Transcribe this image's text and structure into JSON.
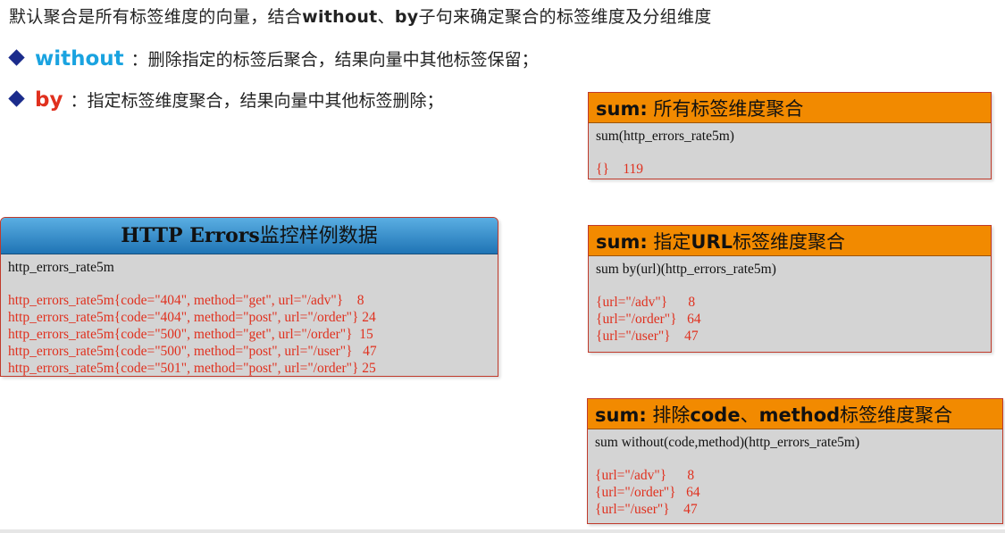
{
  "title": {
    "pre": "默认聚合是所有标签维度的向量，结合",
    "kw1": "without",
    "mid": "、",
    "kw2": "by",
    "post": "子句来确定聚合的标签维度及分组维度"
  },
  "bullets": [
    {
      "keyword": "without",
      "text": "：删除指定的标签后聚合，结果向量中其他标签保留；"
    },
    {
      "keyword": "by",
      "text": "：指定标签维度聚合，结果向量中其他标签删除；"
    }
  ],
  "sample": {
    "header_en": "HTTP Errors",
    "header_cn": "监控样例数据",
    "command": "http_errors_rate5m",
    "rows": [
      "http_errors_rate5m{code=\"404\", method=\"get\", url=\"/adv\"}    8",
      "http_errors_rate5m{code=\"404\", method=\"post\", url=\"/order\"} 24",
      "http_errors_rate5m{code=\"500\", method=\"get\", url=\"/order\"}  15",
      "http_errors_rate5m{code=\"500\", method=\"post\", url=\"/user\"}   47",
      "http_errors_rate5m{code=\"501\", method=\"post\", url=\"/order\"} 25"
    ]
  },
  "box_sum": {
    "header_bold": "sum:",
    "header_text": " 所有标签维度聚合",
    "command": "sum(http_errors_rate5m)",
    "rows": [
      "{}    119"
    ]
  },
  "box_by": {
    "header_bold": "sum:",
    "header_text1": " 指定",
    "header_bold2": "URL",
    "header_text2": "标签维度聚合",
    "command": "sum by(url)(http_errors_rate5m)",
    "rows": [
      "{url=\"/adv\"}      8",
      "{url=\"/order\"}   64",
      "{url=\"/user\"}    47"
    ]
  },
  "box_without": {
    "header_bold": "sum:",
    "header_text1": " 排除",
    "header_bold2": "code",
    "header_text2": "、",
    "header_bold3": "method",
    "header_text3": "标签维度聚合",
    "command": "sum without(code,method)(http_errors_rate5m)",
    "rows": [
      "{url=\"/adv\"}      8",
      "{url=\"/order\"}   64",
      "{url=\"/user\"}    47"
    ]
  }
}
